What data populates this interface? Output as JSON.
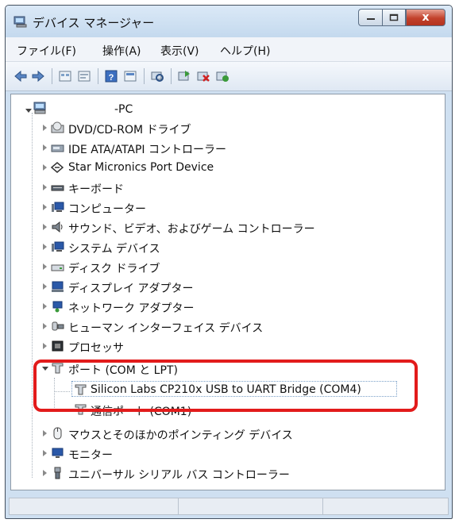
{
  "window": {
    "title": "デバイス マネージャー",
    "controls": {
      "minimize": "minimize",
      "maximize": "maximize",
      "close": "x"
    }
  },
  "menu": [
    {
      "label": "ファイル(F)"
    },
    {
      "label": "操作(A)"
    },
    {
      "label": "表示(V)"
    },
    {
      "label": "ヘルプ(H)"
    }
  ],
  "toolbar_icons": [
    "back-icon",
    "forward-icon",
    "properties-view-icon",
    "show-hide-icon",
    "help-icon",
    "properties-icon",
    "scan-hardware-icon",
    "update-driver-icon",
    "uninstall-icon",
    "enable-device-icon"
  ],
  "tree": {
    "root": {
      "label": "-PC"
    },
    "items": [
      {
        "label": "DVD/CD-ROM ドライブ",
        "icon": "dvd-drive-icon"
      },
      {
        "label": "IDE ATA/ATAPI コントローラー",
        "icon": "ide-controller-icon"
      },
      {
        "label": "Star Micronics Port Device",
        "icon": "port-device-icon"
      },
      {
        "label": "キーボード",
        "icon": "keyboard-icon"
      },
      {
        "label": "コンピューター",
        "icon": "computer-icon"
      },
      {
        "label": "サウンド、ビデオ、およびゲーム コントローラー",
        "icon": "sound-icon"
      },
      {
        "label": "システム デバイス",
        "icon": "system-device-icon"
      },
      {
        "label": "ディスク ドライブ",
        "icon": "disk-drive-icon"
      },
      {
        "label": "ディスプレイ アダプター",
        "icon": "display-adapter-icon"
      },
      {
        "label": "ネットワーク アダプター",
        "icon": "network-adapter-icon"
      },
      {
        "label": "ヒューマン インターフェイス デバイス",
        "icon": "hid-icon"
      },
      {
        "label": "プロセッサ",
        "icon": "processor-icon"
      },
      {
        "label": "ポート (COM と LPT)",
        "icon": "port-icon"
      },
      {
        "label": "Silicon Labs CP210x USB to UART Bridge (COM4)",
        "icon": "port-icon"
      },
      {
        "label": "通信ポート (COM1)",
        "icon": "port-icon"
      },
      {
        "label": "マウスとそのほかのポインティング デバイス",
        "icon": "mouse-icon"
      },
      {
        "label": "モニター",
        "icon": "monitor-icon"
      },
      {
        "label": "ユニバーサル シリアル バス コントローラー",
        "icon": "usb-controller-icon"
      }
    ]
  },
  "colors": {
    "highlight": "#e21b1b",
    "close_button": "#c2412b",
    "selection_border": "#7aa0c8"
  }
}
